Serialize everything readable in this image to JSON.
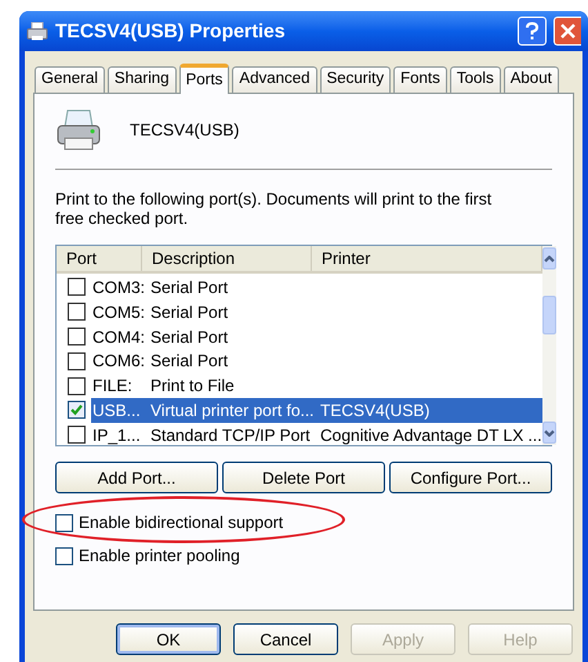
{
  "window": {
    "title": "TECSV4(USB) Properties"
  },
  "tabs": [
    {
      "label": "General",
      "selected": false
    },
    {
      "label": "Sharing",
      "selected": false
    },
    {
      "label": "Ports",
      "selected": true
    },
    {
      "label": "Advanced",
      "selected": false
    },
    {
      "label": "Security",
      "selected": false
    },
    {
      "label": "Fonts",
      "selected": false
    },
    {
      "label": "Tools",
      "selected": false
    },
    {
      "label": "About",
      "selected": false
    }
  ],
  "printer_name": "TECSV4(USB)",
  "instructions": "Print to the following port(s). Documents will print to the first free checked port.",
  "ports": {
    "columns": [
      "Port",
      "Description",
      "Printer"
    ],
    "rows": [
      {
        "port": "COM3:",
        "description": "Serial Port",
        "printer": "",
        "checked": false,
        "selected": false
      },
      {
        "port": "COM5:",
        "description": "Serial Port",
        "printer": "",
        "checked": false,
        "selected": false
      },
      {
        "port": "COM4:",
        "description": "Serial Port",
        "printer": "",
        "checked": false,
        "selected": false
      },
      {
        "port": "COM6:",
        "description": "Serial Port",
        "printer": "",
        "checked": false,
        "selected": false
      },
      {
        "port": "FILE:",
        "description": "Print to File",
        "printer": "",
        "checked": false,
        "selected": false
      },
      {
        "port": "USB...",
        "description": "Virtual printer port fo...",
        "printer": "TECSV4(USB)",
        "checked": true,
        "selected": true
      },
      {
        "port": "IP_1...",
        "description": "Standard TCP/IP Port",
        "printer": "Cognitive Advantage DT LX ...",
        "checked": false,
        "selected": false
      }
    ]
  },
  "port_buttons": [
    "Add Port...",
    "Delete Port",
    "Configure Port..."
  ],
  "options": [
    {
      "label": "Enable bidirectional support",
      "checked": false,
      "circled": true
    },
    {
      "label": "Enable printer pooling",
      "checked": false,
      "circled": false
    }
  ],
  "buttons": [
    {
      "label": "OK",
      "default": true,
      "disabled": false
    },
    {
      "label": "Cancel",
      "default": false,
      "disabled": false
    },
    {
      "label": "Apply",
      "default": false,
      "disabled": true
    },
    {
      "label": "Help",
      "default": false,
      "disabled": true
    }
  ]
}
